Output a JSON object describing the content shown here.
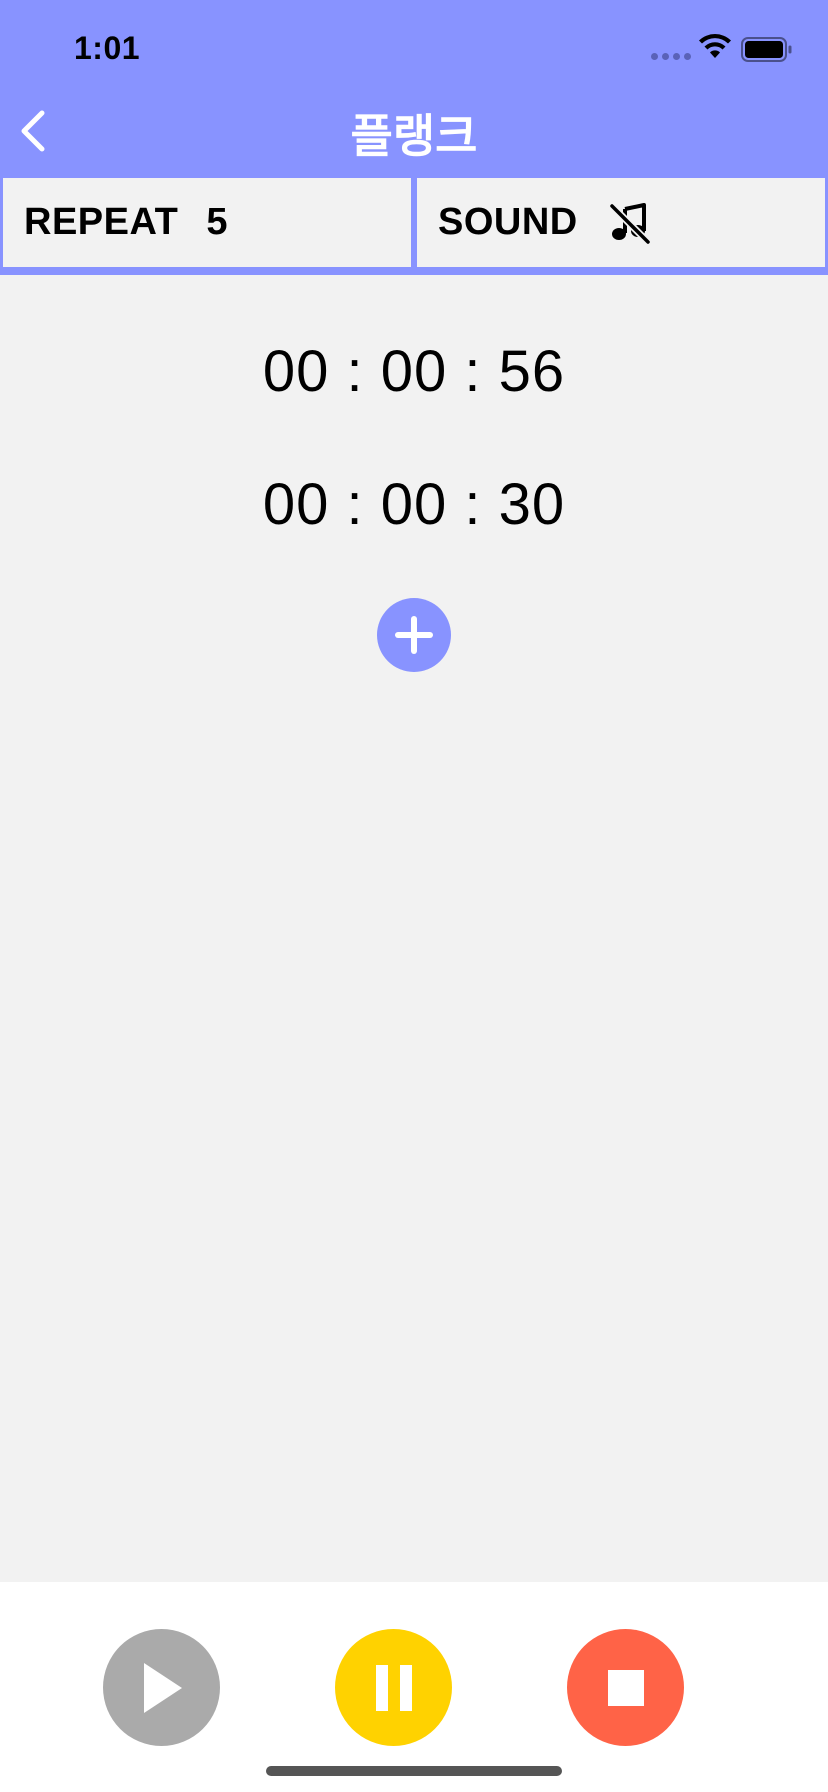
{
  "status_bar": {
    "time": "1:01"
  },
  "nav": {
    "title": "플랭크",
    "back_icon": "chevron-left-icon"
  },
  "settings": {
    "repeat_label": "REPEAT",
    "repeat_value": "5",
    "sound_label": "SOUND",
    "sound_icon": "music-off-icon"
  },
  "timers": [
    {
      "value": "00 : 00 : 56"
    },
    {
      "value": "00 : 00 : 30"
    }
  ],
  "add_icon": "plus-icon",
  "controls": {
    "play_icon": "play-icon",
    "pause_icon": "pause-icon",
    "stop_icon": "stop-icon"
  },
  "colors": {
    "accent": "#8893ff",
    "play": "#aaaaaa",
    "pause": "#ffd200",
    "stop": "#ff6347",
    "background": "#f2f2f2"
  }
}
